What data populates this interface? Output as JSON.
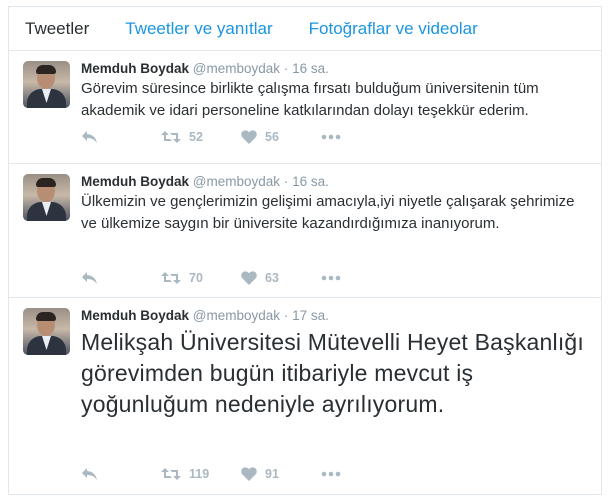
{
  "tabs": [
    {
      "label": "Tweetler",
      "active": true
    },
    {
      "label": "Tweetler ve yanıtlar",
      "active": false
    },
    {
      "label": "Fotoğraflar ve videolar",
      "active": false
    }
  ],
  "tweets": [
    {
      "name": "Memduh Boydak",
      "handle": "@memboydak",
      "separator": "·",
      "time": "16 sa.",
      "text": "Görevim süresince birlikte çalışma fırsatı bulduğum üniversitenin tüm akademik ve idari personeline katkılarından dolayı teşekkür ederim.",
      "retweets": "52",
      "likes": "56"
    },
    {
      "name": "Memduh Boydak",
      "handle": "@memboydak",
      "separator": "·",
      "time": "16 sa.",
      "text": "Ülkemizin ve gençlerimizin gelişimi amacıyla,iyi niyetle çalışarak şehrimize ve ülkemize saygın bir üniversite kazandırdığımıza inanıyorum.",
      "retweets": "70",
      "likes": "63"
    },
    {
      "name": "Memduh Boydak",
      "handle": "@memboydak",
      "separator": "·",
      "time": "17 sa.",
      "text": "Melikşah Üniversitesi Mütevelli Heyet Başkanlığı görevimden bugün itibariyle mevcut iş yoğunluğum nedeniyle ayrılıyorum.",
      "retweets": "119",
      "likes": "91"
    }
  ],
  "colors": {
    "link": "#1b95e0",
    "muted": "#8899a6",
    "icon": "#aab8c2",
    "border": "#e1e8ed"
  },
  "icons": [
    "reply-icon",
    "retweet-icon",
    "heart-icon",
    "more-icon"
  ]
}
